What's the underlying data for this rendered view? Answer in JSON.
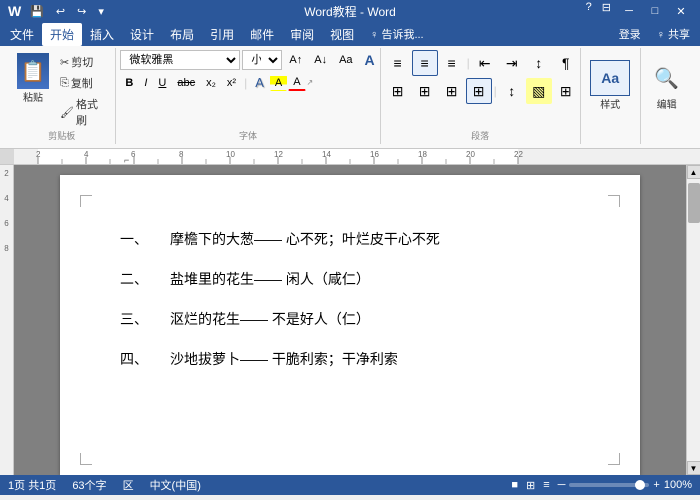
{
  "titleBar": {
    "title": "Word教程 - Word",
    "quickAccess": [
      "↩",
      "↪",
      "💾",
      "⮐"
    ],
    "winControls": [
      "─",
      "□",
      "✕"
    ]
  },
  "menuBar": {
    "items": [
      "文件",
      "开始",
      "插入",
      "设计",
      "布局",
      "引用",
      "邮件",
      "审阅",
      "视图",
      "♀ 告诉我..."
    ],
    "activeItem": "开始",
    "rightItems": [
      "登录",
      "♀ 共享"
    ]
  },
  "ribbon": {
    "clipboard": {
      "label": "剪贴板",
      "pasteLabel": "粘贴",
      "buttons": [
        "剪切",
        "复制",
        "格式刷"
      ]
    },
    "font": {
      "label": "字体",
      "fontName": "微软雅黑",
      "fontSize": "小四",
      "boldLabel": "B",
      "italicLabel": "I",
      "underlineLabel": "U",
      "strikeLabel": "abc",
      "subLabel": "x₂",
      "supLabel": "x²",
      "buttons": [
        "A↑",
        "A↓",
        "文A",
        "A",
        "A",
        "A"
      ]
    },
    "paragraph": {
      "label": "段落",
      "buttons": [
        "≡",
        "≡",
        "≡",
        "⊞",
        "↕",
        "⊞"
      ]
    },
    "styles": {
      "label": "样式",
      "button": "样式"
    },
    "editing": {
      "label": "",
      "button": "编辑"
    }
  },
  "document": {
    "lines": [
      {
        "num": "一、",
        "text": "摩檐下的大葱—— 心不死；叶烂皮干心不死"
      },
      {
        "num": "二、",
        "text": "盐堆里的花生—— 闲人（咸仁）"
      },
      {
        "num": "三、",
        "text": "沤烂的花生—— 不是好人（仁）"
      },
      {
        "num": "四、",
        "text": "沙地拔萝卜—— 干脆利索；干净利索"
      }
    ]
  },
  "statusBar": {
    "page": "1页",
    "totalPages": "共1页",
    "wordCount": "63个字",
    "section": "区",
    "language": "中文(中国)",
    "zoomPercent": "100%",
    "viewButtons": [
      "■",
      "⊞",
      "≡"
    ]
  },
  "icons": {
    "paste": "📋",
    "cut": "✂",
    "copy": "⎘",
    "formatPainter": "🖌",
    "bold": "B",
    "italic": "I",
    "underline": "U",
    "search": "🔍",
    "styles": "Aa"
  }
}
